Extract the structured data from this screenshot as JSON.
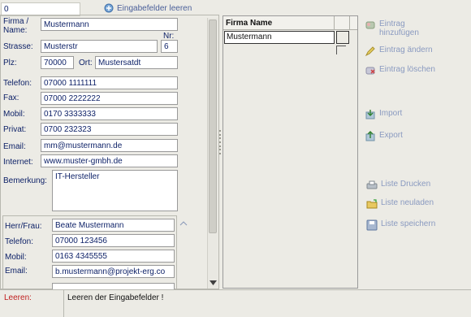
{
  "toolbar": {
    "counter_value": "0",
    "clear_fields_label": "Eingabefelder leeren"
  },
  "form": {
    "company_label": "Firma / Name:",
    "company_value": "Mustermann",
    "street_label": "Strasse:",
    "street_value": "Musterstr",
    "number_label": "Nr:",
    "number_value": "6",
    "zip_label": "Plz:",
    "zip_value": "70000",
    "city_label": "Ort:",
    "city_value": "Mustersatdt",
    "phone_label": "Telefon:",
    "phone_value": "07000 1111111",
    "fax_label": "Fax:",
    "fax_value": "07000 2222222",
    "mobile_label": "Mobil:",
    "mobile_value": "0170 3333333",
    "private_label": "Privat:",
    "private_value": "0700 232323",
    "email_label": "Email:",
    "email_value": "mm@mustermann.de",
    "internet_label": "Internet:",
    "internet_value": "www.muster-gmbh.de",
    "remark_label": "Bemerkung:",
    "remark_value": "IT-Hersteller"
  },
  "contact": {
    "salutation_label": "Herr/Frau:",
    "salutation_value": "Beate Mustermann",
    "phone_label": "Telefon:",
    "phone_value": "07000 123456",
    "mobile_label": "Mobil:",
    "mobile_value": "0163 4345555",
    "email_label": "Email:",
    "email_value": "b.mustermann@projekt-erg.co"
  },
  "list": {
    "column_header": "Firma Name",
    "rows": [
      "Mustermann"
    ]
  },
  "actions": {
    "add_entry": "Eintrag hinzufügen",
    "edit_entry": "Eintrag ändern",
    "delete_entry": "Eintrag löschen",
    "import": "Import",
    "export": "Export",
    "print_list": "Liste Drucken",
    "reload_list": "Liste neuladen",
    "save_list": "Liste speichern"
  },
  "status": {
    "label": "Leeren:",
    "message": "Leeren der Eingabefelder !"
  },
  "colors": {
    "label_text": "#0b1f66",
    "status_label": "#c02020",
    "link_disabled": "#8a9ac0",
    "background": "#ecebe5"
  }
}
